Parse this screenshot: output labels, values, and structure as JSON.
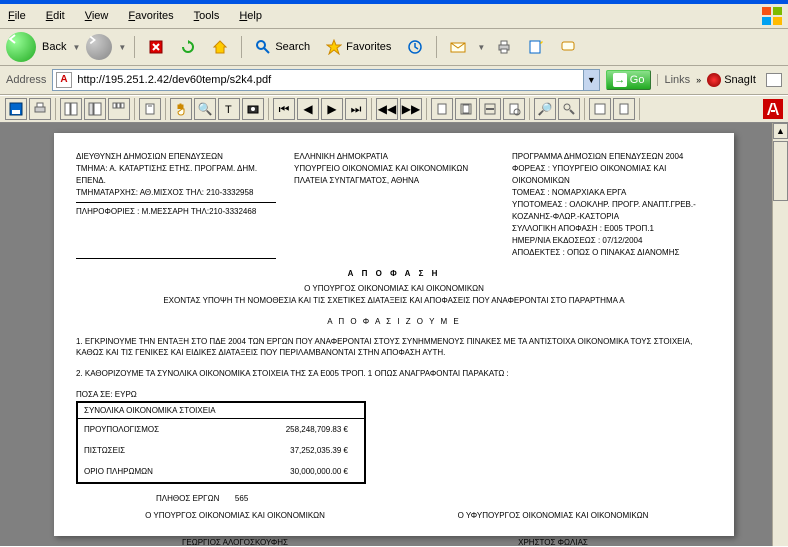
{
  "menu": {
    "file": "File",
    "edit": "Edit",
    "view": "View",
    "favorites": "Favorites",
    "tools": "Tools",
    "help": "Help"
  },
  "toolbar": {
    "back": "Back",
    "search": "Search",
    "favorites": "Favorites"
  },
  "address": {
    "label": "Address",
    "url": "http://195.251.2.42/dev60temp/s2k4.pdf",
    "go": "Go",
    "links": "Links",
    "snagit": "SnagIt"
  },
  "doc": {
    "left": {
      "l1": "ΔΙΕΥΘΥΝΣΗ ΔΗΜΟΣΙΩΝ ΕΠΕΝΔΥΣΕΩΝ",
      "l2": "ΤΜΗΜΑ: Α. ΚΑΤΑΡΤΙΣΗΣ ΕΤΗΣ. ΠΡΟΓΡΑΜ. ΔΗΜ. ΕΠΕΝΔ.",
      "l3": "ΤΜΗΜΑΤΑΡΧΗΣ:  ΑΘ.ΜΙΣΧΟΣ ΤΗΛ: 210-3332958",
      "l4": "ΠΛΗΡΟΦΟΡΙΕΣ : Μ.ΜΕΣΣΑΡΗ ΤΗΛ:210-3332468"
    },
    "center_col": {
      "c1": "ΕΛΛΗΝΙΚΗ ΔΗΜΟΚΡΑΤΙΑ",
      "c2": "ΥΠΟΥΡΓΕΙΟ ΟΙΚΟΝΟΜΙΑΣ ΚΑΙ ΟΙΚΟΝΟΜΙΚΩΝ",
      "c3": "ΠΛΑΤΕΙΑ ΣΥΝΤΑΓΜΑΤΟΣ, ΑΘΗΝΑ"
    },
    "right": {
      "r1": "ΠΡΟΓΡΑΜΜΑ ΔΗΜΟΣΙΩΝ ΕΠΕΝΔΥΣΕΩΝ 2004",
      "r2": "ΦΟΡΕΑΣ :  ΥΠΟΥΡΓΕΙΟ ΟΙΚΟΝΟΜΙΑΣ ΚΑΙ ΟΙΚΟΝΟΜΙΚΩΝ",
      "r3": "ΤΟΜΕΑΣ :  ΝΟΜΑΡΧΙΑΚΑ ΕΡΓΑ",
      "r4": "ΥΠΟΤΟΜΕΑΣ :  ΟΛΟΚΛΗΡ. ΠΡΟΓΡ. ΑΝΑΠΤ.ΓΡΕΒ.-ΚΟΖΑΝΗΣ-ΦΛΩΡ.-ΚΑΣΤΟΡΙΑ",
      "r5": "ΣΥΛΛΟΓΙΚΗ ΑΠΟΦΑΣΗ : E005 ΤΡΟΠ.1",
      "r6": "ΗΜΕΡ/ΝΙΑ ΕΚΔΟΣΕΩΣ :  07/12/2004",
      "r7": "ΑΠΟΔΕΚΤΕΣ : ΟΠΩΣ Ο ΠΙΝΑΚΑΣ ΔΙΑΝΟΜΗΣ"
    },
    "title": "Α Π Ο Φ Α Σ Η",
    "sub1": "Ο ΥΠΟΥΡΓΟΣ ΟΙΚΟΝΟΜΙΑΣ ΚΑΙ ΟΙΚΟΝΟΜΙΚΩΝ",
    "sub2": "ΕΧΟΝΤΑΣ ΥΠΟΨΗ ΤΗ ΝΟΜΟΘΕΣΙΑ ΚΑΙ ΤΙΣ ΣΧΕΤΙΚΕΣ ΔΙΑΤΑΞΕΙΣ ΚΑΙ ΑΠΟΦΑΣΕΙΣ ΠΟΥ ΑΝΑΦΕΡΟΝΤΑΙ ΣΤΟ ΠΑΡΑΡΤΗΜΑ Α",
    "decide": "Α Π Ο Φ Α Σ Ι Ζ Ο Υ Μ Ε",
    "p1": "1. ΕΓΚΡΙΝΟΥΜΕ ΤΗΝ ΕΝΤΑΞΗ ΣΤΟ ΠΔΕ 2004      ΤΩΝ ΕΡΓΩΝ ΠΟΥ ΑΝΑΦΕΡΟΝΤΑΙ ΣΤΟΥΣ ΣΥΝΗΜΜΕΝΟΥΣ ΠΙΝΑΚΕΣ ΜΕ ΤΑ ΑΝΤΙΣΤΟΙΧΑ ΟΙΚΟΝΟΜΙΚΑ ΤΟΥΣ ΣΤΟΙΧΕΙΑ, ΚΑΘΩΣ ΚΑΙ ΤΙΣ ΓΕΝΙΚΕΣ ΚΑΙ ΕΙΔΙΚΕΣ ΔΙΑΤΑΞΕΙΣ ΠΟΥ ΠΕΡΙΛΑΜΒΑΝΟΝΤΑΙ ΣΤΗΝ ΑΠΟΦΑΣΗ ΑΥΤΗ.",
    "p2": "2. ΚΑΘΟΡΙΖΟΥΜΕ ΤΑ ΣΥΝΟΛΙΚΑ ΟΙΚΟΝΟΜΙΚΑ ΣΤΟΙΧΕΙΑ ΤΗΣ ΣΑ E005 ΤΡΟΠ. 1        ΟΠΩΣ ΑΝΑΓΡΑΦΟΝΤΑΙ ΠΑΡΑΚΑΤΩ :",
    "posa": "ΠΟΣΑ ΣΕ:  ΕΥΡΩ",
    "tableHeader": "ΣΥΝΟΛΙΚΑ ΟΙΚΟΝΟΜΙΚΑ ΣΤΟΙΧΕΙΑ",
    "rows": [
      {
        "lbl": "ΠΡΟΥΠΟΛΟΓΙΣΜΟΣ",
        "val": "258,248,709.83 €"
      },
      {
        "lbl": "ΠΙΣΤΩΣΕΙΣ",
        "val": "37,252,035.39 €"
      },
      {
        "lbl": "ΟΡΙΟ ΠΛΗΡΩΜΩΝ",
        "val": "30,000,000.00 €"
      }
    ],
    "countLabel": "ΠΛΗΘΟΣ ΕΡΓΩΝ",
    "countVal": "565",
    "sig1": "Ο ΥΠΟΥΡΓΟΣ ΟΙΚΟΝΟΜΙΑΣ ΚΑΙ ΟΙΚΟΝΟΜΙΚΩΝ",
    "sig2": "Ο ΥΦΥΠΟΥΡΓΟΣ ΟΙΚΟΝΟΜΙΑΣ ΚΑΙ ΟΙΚΟΝΟΜΙΚΩΝ",
    "name1": "ΓΕΩΡΓΙΟΣ ΑΛΟΓΟΣΚΟΥΦΗΣ",
    "name2": "ΧΡΗΣΤΟΣ ΦΩΛΙΑΣ"
  }
}
